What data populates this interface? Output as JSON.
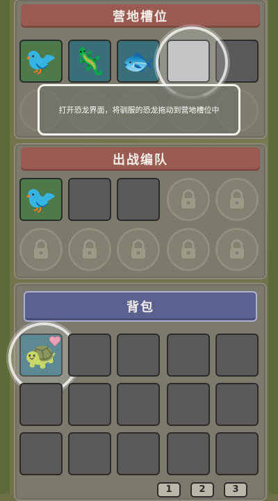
{
  "camp": {
    "title": "营地槽位",
    "slots": [
      {
        "icon": "toucan-icon",
        "glyph": "🐦",
        "state": "filled"
      },
      {
        "icon": "ankylosaur-icon",
        "glyph": "🦎",
        "state": "filled"
      },
      {
        "icon": "fish-icon",
        "glyph": "🐟",
        "state": "filled"
      },
      {
        "icon": "",
        "glyph": "",
        "state": "empty-highlighted"
      },
      {
        "icon": "",
        "glyph": "",
        "state": "empty"
      }
    ]
  },
  "tooltip": {
    "text": "打开恐龙界面，将驯服的恐龙拖动到营地槽位中"
  },
  "team": {
    "title": "出战编队",
    "slots": [
      {
        "icon": "toucan-icon",
        "glyph": "🐦",
        "state": "filled"
      },
      {
        "icon": "",
        "glyph": "",
        "state": "empty"
      },
      {
        "icon": "",
        "glyph": "",
        "state": "empty"
      },
      {
        "state": "locked"
      },
      {
        "state": "locked"
      },
      {
        "state": "locked"
      },
      {
        "state": "locked"
      },
      {
        "state": "locked"
      },
      {
        "state": "locked"
      },
      {
        "state": "locked"
      }
    ]
  },
  "backpack": {
    "title": "背包",
    "first_item": {
      "icon": "turtle-icon",
      "glyph": "🐢",
      "favorite": "heart-icon"
    },
    "pages": [
      "1",
      "2",
      "3"
    ]
  },
  "colors": {
    "header_red": "#9a5b53",
    "header_blue": "#5b628f",
    "heart": "#e98aa6"
  }
}
